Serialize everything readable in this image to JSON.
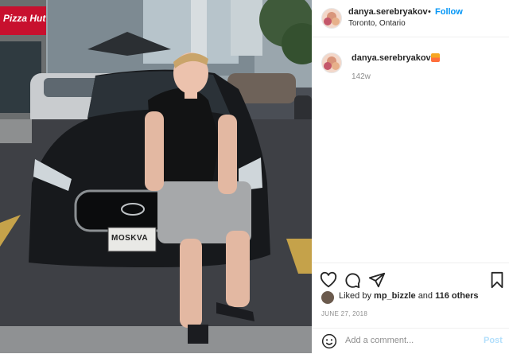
{
  "post": {
    "username": "danya.serebryakov",
    "follow_label": "Follow",
    "separator": "•",
    "location": "Toronto, Ontario",
    "caption_emoji": "sunset-emoji",
    "caption_age": "142w",
    "likes_prefix": "Liked by",
    "liked_by_user": "mp_bizzle",
    "likes_connector": "and",
    "likes_others": "116 others",
    "date": "JUNE 27, 2018",
    "comment_placeholder": "Add a comment...",
    "post_label": "Post",
    "sign_store": "Pizza Hut",
    "plate_text": "MOSKVA"
  },
  "icons": [
    "heart-icon",
    "comment-icon",
    "share-icon",
    "bookmark-icon",
    "emoji-icon"
  ],
  "colors": {
    "link_blue": "#0095f6",
    "post_disabled": "#b2dffc",
    "text": "#262626",
    "muted": "#8e8e8e"
  }
}
